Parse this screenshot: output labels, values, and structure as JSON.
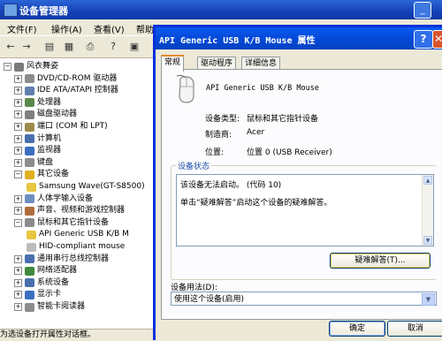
{
  "device_manager": {
    "title": "设备管理器",
    "minimize_glyph": "_",
    "menu": [
      "文件(F)",
      "操作(A)",
      "查看(V)",
      "帮助"
    ],
    "toolbar_icons": [
      "back-icon",
      "forward-icon",
      "properties-list-icon",
      "print-icon",
      "help-icon",
      "view-icon"
    ],
    "tree": [
      {
        "label": "风衣舞姿",
        "expander": "−",
        "color": "#7a7a7a"
      },
      {
        "label": "DVD/CD-ROM 驱动器",
        "expander": "+",
        "color": "#8c8c8c"
      },
      {
        "label": "IDE ATA/ATAPI 控制器",
        "expander": "+",
        "color": "#5f7fae"
      },
      {
        "label": "处理器",
        "expander": "+",
        "color": "#5a8a4a"
      },
      {
        "label": "磁盘驱动器",
        "expander": "+",
        "color": "#7f7f7f"
      },
      {
        "label": "端口 (COM 和 LPT)",
        "expander": "+",
        "color": "#9c8b4a"
      },
      {
        "label": "计算机",
        "expander": "+",
        "color": "#4a6fae"
      },
      {
        "label": "监视器",
        "expander": "+",
        "color": "#3b6fc2"
      },
      {
        "label": "键盘",
        "expander": "+",
        "color": "#8c8c8c"
      },
      {
        "label": "其它设备",
        "expander": "−",
        "color": "#e0b020"
      },
      {
        "label": "Samsung Wave(GT-S8500)",
        "expander": "",
        "color": "#e8c640",
        "indent": 1
      },
      {
        "label": "人体学输入设备",
        "expander": "+",
        "color": "#6e8fbf"
      },
      {
        "label": "声音、视频和游戏控制器",
        "expander": "+",
        "color": "#b06b3a"
      },
      {
        "label": "鼠标和其它指针设备",
        "expander": "−",
        "color": "#8c8c8c"
      },
      {
        "label": "API Generic USB K/B M",
        "expander": "",
        "color": "#e8c640",
        "indent": 1,
        "selected": false
      },
      {
        "label": "HID-compliant mouse",
        "expander": "",
        "color": "#bcbcbc",
        "indent": 1
      },
      {
        "label": "通用串行总线控制器",
        "expander": "+",
        "color": "#4a6fae"
      },
      {
        "label": "网络适配器",
        "expander": "+",
        "color": "#3d8a3d"
      },
      {
        "label": "系统设备",
        "expander": "+",
        "color": "#4a6fae"
      },
      {
        "label": "显示卡",
        "expander": "+",
        "color": "#3b6fc2"
      },
      {
        "label": "智能卡阅读器",
        "expander": "+",
        "color": "#8c8c8c"
      }
    ],
    "status_text": "为选设备打开属性对话框。"
  },
  "dialog": {
    "title": "API Generic USB K/B Mouse 属性",
    "help_glyph": "?",
    "close_glyph": "✕",
    "tabs": [
      "常规",
      "驱动程序",
      "详细信息"
    ],
    "device_name": "API Generic USB K/B Mouse",
    "props": [
      {
        "label": "设备类型:",
        "value": "鼠标和其它指针设备"
      },
      {
        "label": "制造商:",
        "value": "Acer"
      },
      {
        "label": "位置:",
        "value": "位置 0 (USB Receiver)"
      }
    ],
    "status_group_label": "设备状态",
    "status_line1": "该设备无法启动。 (代码 10)",
    "status_line2": "单击“疑难解答”启动这个设备的疑难解答。",
    "troubleshoot_label": "疑难解答(T)...",
    "usage_label": "设备用法(D):",
    "usage_value": "使用这个设备(启用)",
    "ok_label": "确定",
    "cancel_label": "取消"
  }
}
